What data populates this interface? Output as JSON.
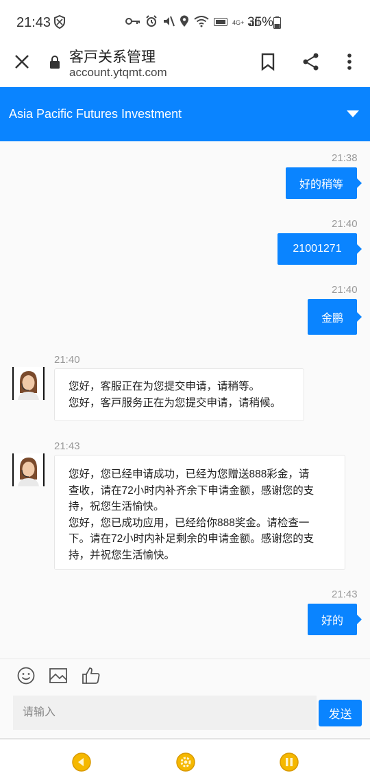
{
  "status_bar": {
    "time": "21:43",
    "battery_percent": "35%",
    "icons": [
      "shield-icon",
      "key-icon",
      "alarm-icon",
      "mute-icon",
      "location-icon",
      "wifi-icon",
      "volte-icon",
      "signal-icon",
      "battery-icon"
    ],
    "network_label": "4G+"
  },
  "browser": {
    "title": "客戸关系管理",
    "url": "account.ytqmt.com"
  },
  "header": {
    "title": "Asia Pacific Futures Investment"
  },
  "messages": [
    {
      "direction": "out",
      "time": "21:38",
      "text": "好的稍等"
    },
    {
      "direction": "out",
      "time": "21:40",
      "text": "21001271"
    },
    {
      "direction": "out",
      "time": "21:40",
      "text": "金鹏"
    },
    {
      "direction": "in",
      "time": "21:40",
      "lines": [
        "您好，客服正在为您提交申请，请稍等。",
        "您好，客戸服务正在为您提交申请，请稍候。"
      ]
    },
    {
      "direction": "in",
      "time": "21:43",
      "lines": [
        "您好，您已经申请成功，已经为您赠送888彩金，请",
        "查收，请在72小时内补齐余下申请金额，感谢您的支",
        "持，祝您生活愉快。",
        "您好，您已成功应用，已经给你888奖金。请检查一",
        "下。请在72小时内补足剩余的申请金额。感谢您的支",
        "持，并祝您生活愉快。"
      ]
    },
    {
      "direction": "out",
      "time": "21:43",
      "text": "好的"
    }
  ],
  "composer": {
    "placeholder": "请输入",
    "value": "",
    "send_label": "发送",
    "tools": [
      "emoji-icon",
      "image-icon",
      "thumbs-up-icon"
    ]
  },
  "bottom_nav": {
    "buttons": [
      "back-icon",
      "settings-icon",
      "pause-icon"
    ],
    "accent_color": "#f5b800"
  },
  "colors": {
    "accent": "#0a84ff",
    "background": "#fafafa"
  }
}
